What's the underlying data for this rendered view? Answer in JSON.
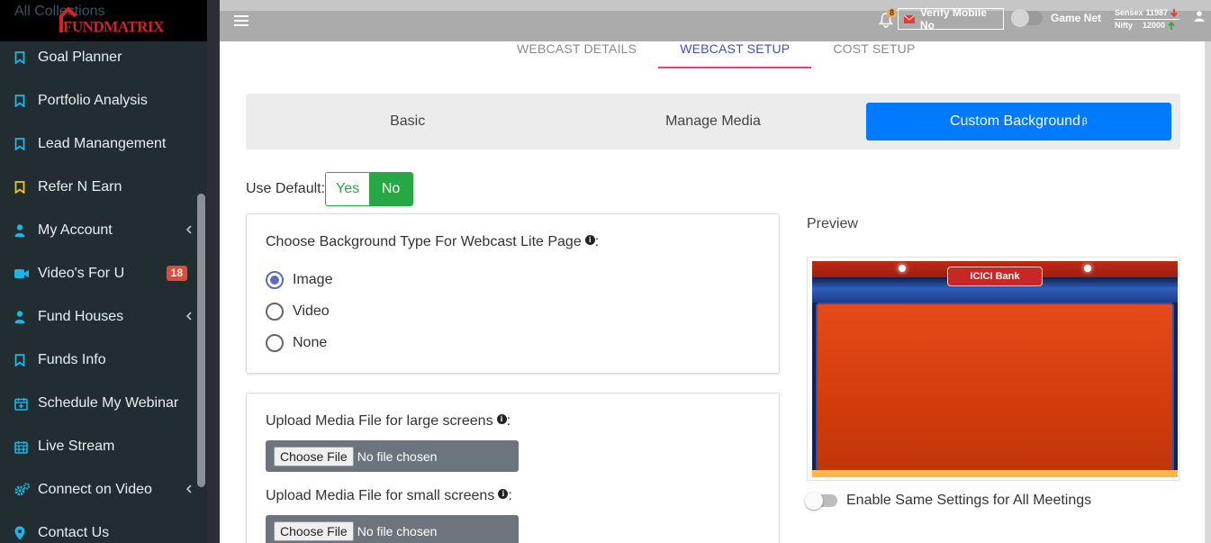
{
  "brand": {
    "name": "FUNDMATRIX",
    "hidden_item": "All Collections"
  },
  "sidebar": {
    "items": [
      {
        "label": "Goal Planner",
        "icon": "bookmark-icon",
        "icon_color": "#1fb4e6"
      },
      {
        "label": "Portfolio Analysis",
        "icon": "bookmark-icon",
        "icon_color": "#1fb4e6"
      },
      {
        "label": "Lead Manangement",
        "icon": "bookmark-icon",
        "icon_color": "#1fb4e6"
      },
      {
        "label": "Refer N Earn",
        "icon": "bookmark-icon",
        "icon_color": "#f0c419"
      },
      {
        "label": "My Account",
        "icon": "user-icon",
        "icon_color": "#1fb4e6",
        "has_arrow": true
      },
      {
        "label": "Video's For U",
        "icon": "video-icon",
        "icon_color": "#1fb4e6",
        "badge": "18"
      },
      {
        "label": "Fund Houses",
        "icon": "user-icon",
        "icon_color": "#1fb4e6",
        "has_arrow": true
      },
      {
        "label": "Funds Info",
        "icon": "bookmark-icon",
        "icon_color": "#1fb4e6"
      },
      {
        "label": "Schedule My Webinar",
        "icon": "calendar-plus-icon",
        "icon_color": "#1fb4e6"
      },
      {
        "label": "Live Stream",
        "icon": "calendar-icon",
        "icon_color": "#1fb4e6"
      },
      {
        "label": "Connect on Video",
        "icon": "cogs-icon",
        "icon_color": "#1fb4e6",
        "has_arrow": true
      },
      {
        "label": "Contact Us",
        "icon": "map-marker-icon",
        "icon_color": "#1fb4e6"
      }
    ]
  },
  "header": {
    "notification_count": "8",
    "verify_label": "Verify Mobile No",
    "game_net_label": "Game Net",
    "sensex_label": "Sensex",
    "sensex_value": "11987",
    "nifty_label": "Nifty",
    "nifty_value": "12000"
  },
  "tabs": [
    "WEBCAST DETAILS",
    "WEBCAST SETUP",
    "COST SETUP"
  ],
  "active_tab": "WEBCAST SETUP",
  "segments": [
    "Basic",
    "Manage Media",
    "Custom Background"
  ],
  "segment_superscript": "β",
  "active_segment": "Custom Background",
  "use_default": {
    "label": "Use Default:",
    "yes": "Yes",
    "no": "No",
    "selected": "No"
  },
  "background_type": {
    "title": "Choose Background Type For Webcast Lite Page",
    "suffix": ":",
    "options": [
      "Image",
      "Video",
      "None"
    ],
    "selected": "Image"
  },
  "upload": {
    "large_title": "Upload Media File for large screens",
    "small_title": "Upload Media File for small screens",
    "suffix": ":",
    "button_label": "Choose File",
    "status_text": "No file chosen"
  },
  "preview": {
    "label": "Preview",
    "bank_name": "ICICI Bank"
  },
  "enable_same": {
    "label": "Enable Same Settings for All Meetings"
  },
  "colors": {
    "primary": "#007bff",
    "success": "#28a745",
    "sidebar": "#222d32",
    "accent_tab": "#3f51b5",
    "tab_underline": "#ec407a"
  }
}
